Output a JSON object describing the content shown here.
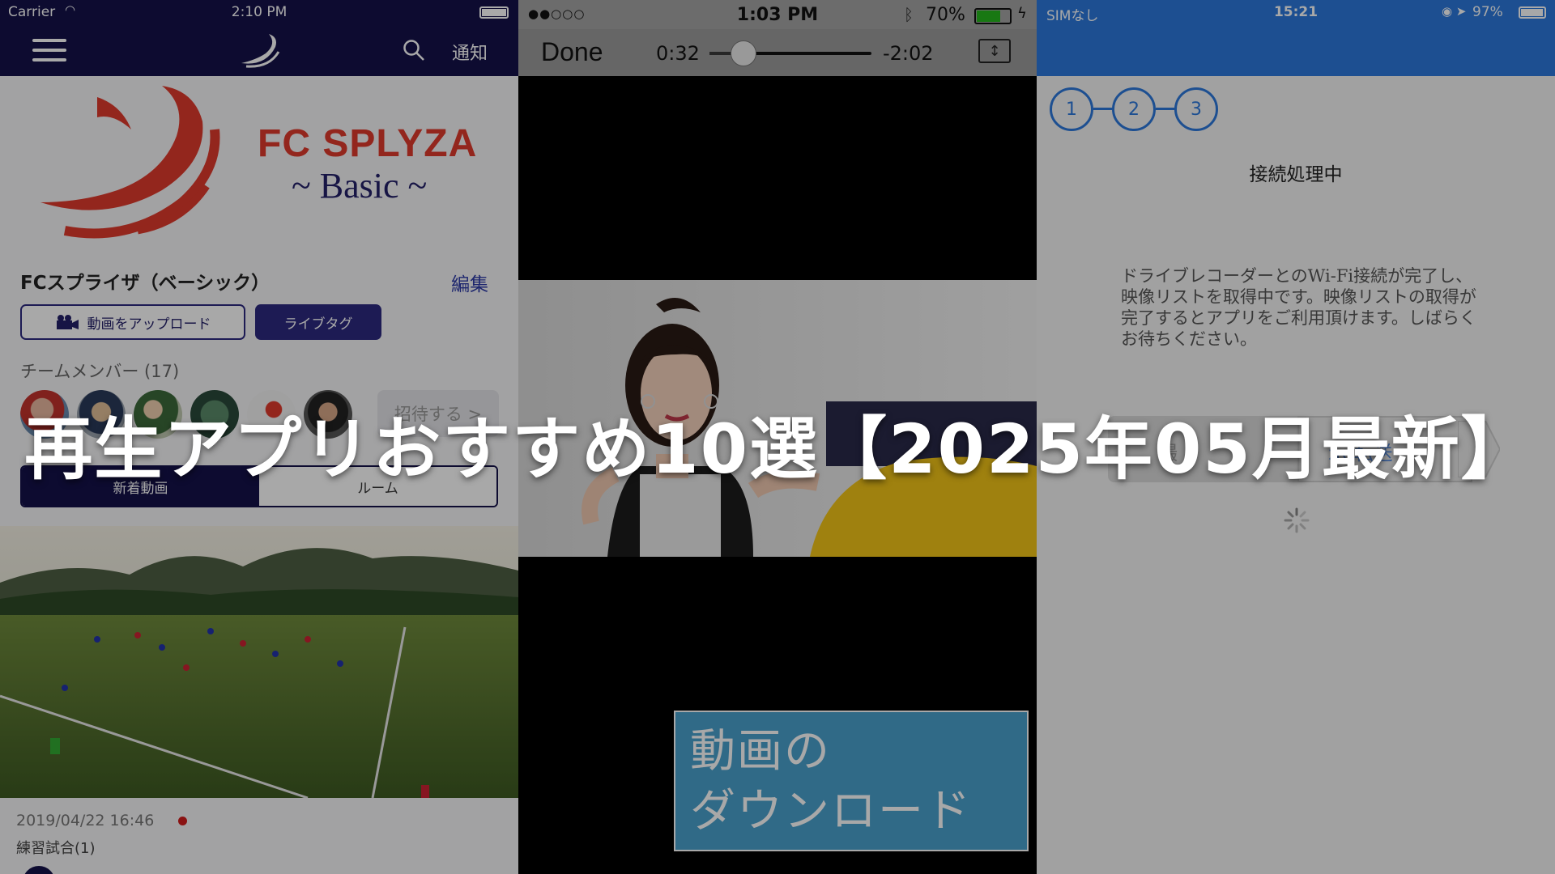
{
  "headline": "再生アプリおすすめ10選【2025年05月最新】",
  "panels": {
    "splyza": {
      "status": {
        "carrier": "Carrier",
        "time": "2:10 PM"
      },
      "nav": {
        "notifications": "通知"
      },
      "brand": {
        "name": "FC SPLYZA",
        "sub": "~ Basic ~"
      },
      "team": {
        "title": "FCスプライザ（ベーシック）",
        "edit": "編集"
      },
      "buttons": {
        "upload": "動画をアップロード",
        "livetag": "ライブタグ",
        "invite": "招待する >"
      },
      "members_label": "チームメンバー (17)",
      "segment": {
        "new_videos": "新着動画",
        "rooms": "ルーム"
      },
      "post": {
        "date": "2019/04/22 16:46",
        "title": "練習試合(1)"
      },
      "colors": {
        "navy": "#14124a",
        "brand_red": "#e03a2c",
        "link_blue": "#2d3aa8"
      }
    },
    "player": {
      "status": {
        "signal": "●●○○○",
        "time": "1:03 PM",
        "battery": "70%"
      },
      "controls": {
        "done": "Done",
        "elapsed": "0:32",
        "remaining": "-2:02",
        "progress": 0.21,
        "fit_icon": "↕"
      },
      "banner": {
        "line1": "動画の",
        "line2": "ダウンロード"
      },
      "colors": {
        "banner": "#4aa1cd",
        "battery": "#25b61e"
      }
    },
    "dashcam": {
      "status": {
        "carrier": "SIMなし",
        "time": "15:21",
        "battery": "97%"
      },
      "steps": [
        "1",
        "2",
        "3"
      ],
      "title": "接続処理中",
      "message": "ドライブレコーダーとのWi-Fi接続が完了し、映像リストを取得中です。映像リストの取得が完了するとアプリをご利用頂けます。しばらくお待ちください。",
      "tabs": {
        "left": "撮",
        "right": "示 転送"
      },
      "colors": {
        "accent": "#2c79dc"
      }
    }
  }
}
